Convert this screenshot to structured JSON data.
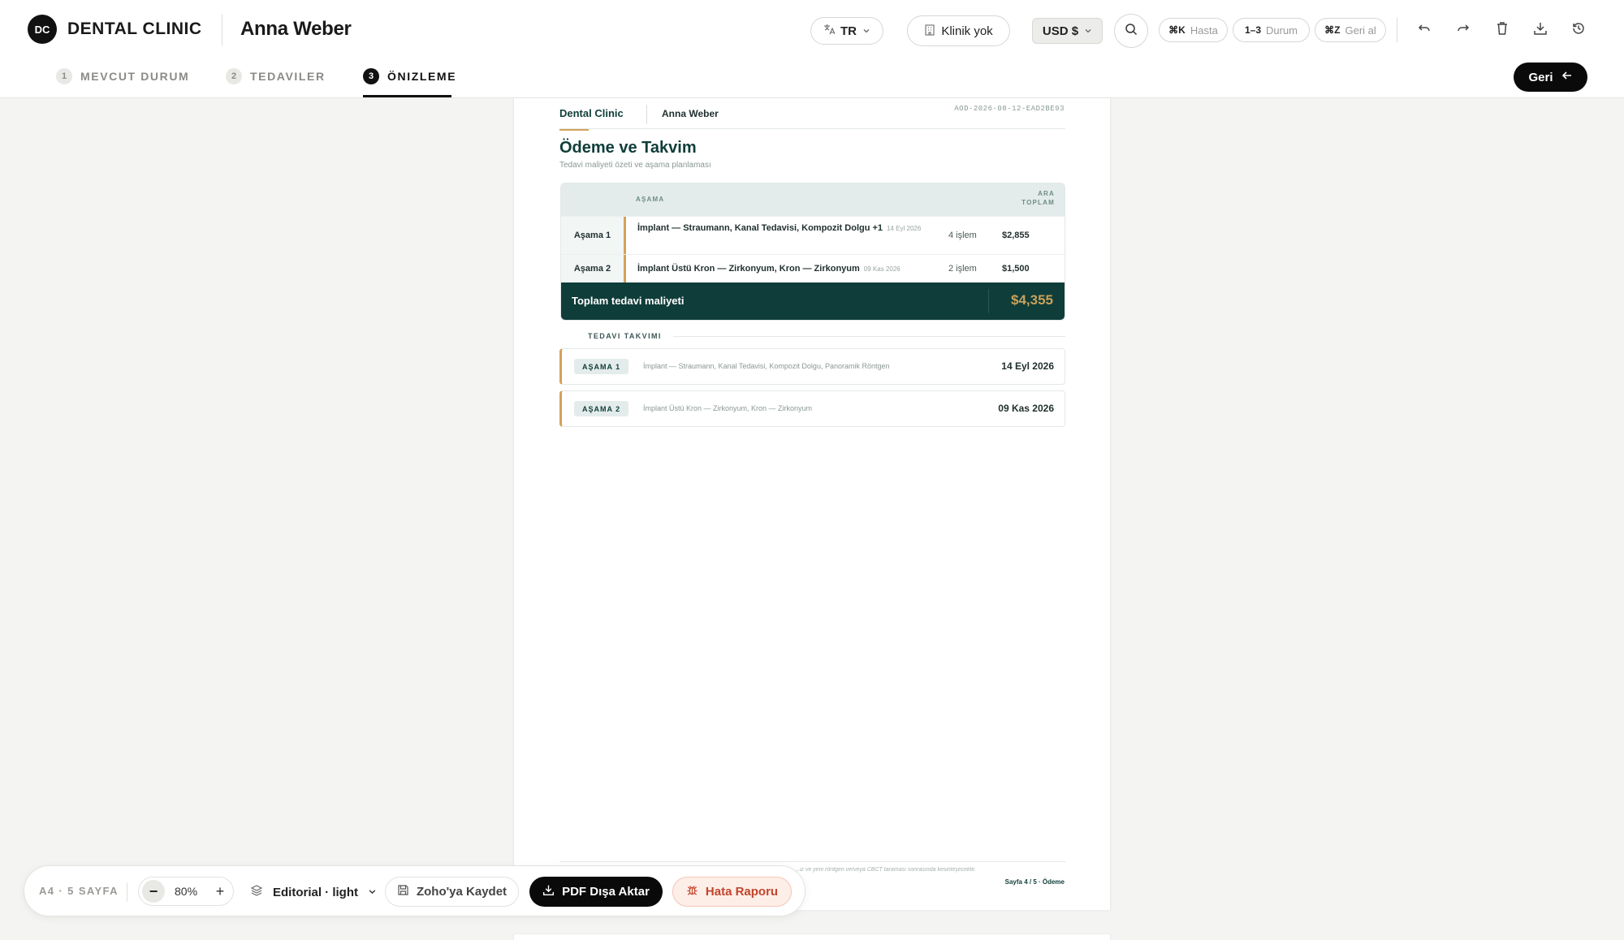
{
  "header": {
    "logo_initials": "DC",
    "brand": "DENTAL CLINIC",
    "patient_name": "Anna Weber",
    "language": "TR",
    "clinic": "Klinik yok",
    "currency": "USD $",
    "shortcuts": [
      {
        "key": "⌘K",
        "label": "Hasta"
      },
      {
        "key": "1–3",
        "label": "Durum"
      },
      {
        "key": "⌘Z",
        "label": "Geri al"
      }
    ],
    "back_label": "Geri"
  },
  "steps": [
    {
      "num": "1",
      "label": "MEVCUT DURUM"
    },
    {
      "num": "2",
      "label": "TEDAVILER"
    },
    {
      "num": "3",
      "label": "ÖNIZLEME"
    }
  ],
  "document": {
    "brand": "Dental Clinic",
    "patient": "Anna Weber",
    "doc_id": "AOD-2026-08-12-EAD2BE93",
    "title": "Ödeme ve Takvim",
    "subtitle": "Tedavi maliyeti özeti ve aşama planlaması",
    "table": {
      "col_stage": "AŞAMA",
      "col_subtotal_1": "ARA",
      "col_subtotal_2": "TOPLAM",
      "rows": [
        {
          "phase": "Aşama 1",
          "desc": "İmplant — Straumann, Kanal Tedavisi, Kompozit Dolgu +1",
          "date": "14 Eyl 2026",
          "count": "4 işlem",
          "amount": "$2,855"
        },
        {
          "phase": "Aşama 2",
          "desc": "İmplant Üstü Kron — Zirkonyum, Kron — Zirkonyum",
          "date": "09 Kas 2026",
          "count": "2 işlem",
          "amount": "$1,500"
        }
      ],
      "total_label": "Toplam tedavi maliyeti",
      "total_amount": "$4,355"
    },
    "schedule": {
      "title": "TEDAVI TAKVIMI",
      "items": [
        {
          "badge": "AŞAMA 1",
          "desc": "İmplant — Straumann, Kanal Tedavisi, Kompozit Dolgu, Panoramik Röntgen",
          "date": "14 Eyl 2026"
        },
        {
          "badge": "AŞAMA 2",
          "desc": "İmplant Üstü Kron — Zirkonyum, Kron — Zirkonyum",
          "date": "09 Kas 2026"
        }
      ]
    },
    "footer_note": "...iz ve yeni röntgen ve/veya CBCT taraması sonrasında kesinleşecektir.",
    "footer_page": "Sayfa 4 / 5 · Ödeme"
  },
  "toolbar": {
    "format": "A4 · 5 SAYFA",
    "zoom": "80%",
    "theme": "Editorial · light",
    "save_zoho": "Zoho'ya Kaydet",
    "export_pdf": "PDF Dışa Aktar",
    "bug_report": "Hata Raporu"
  },
  "colors": {
    "primary_dark": "#0f3d39",
    "accent_gold": "#d4a15a",
    "total_gold": "#c9a15b",
    "bug_red": "#c2452b"
  }
}
